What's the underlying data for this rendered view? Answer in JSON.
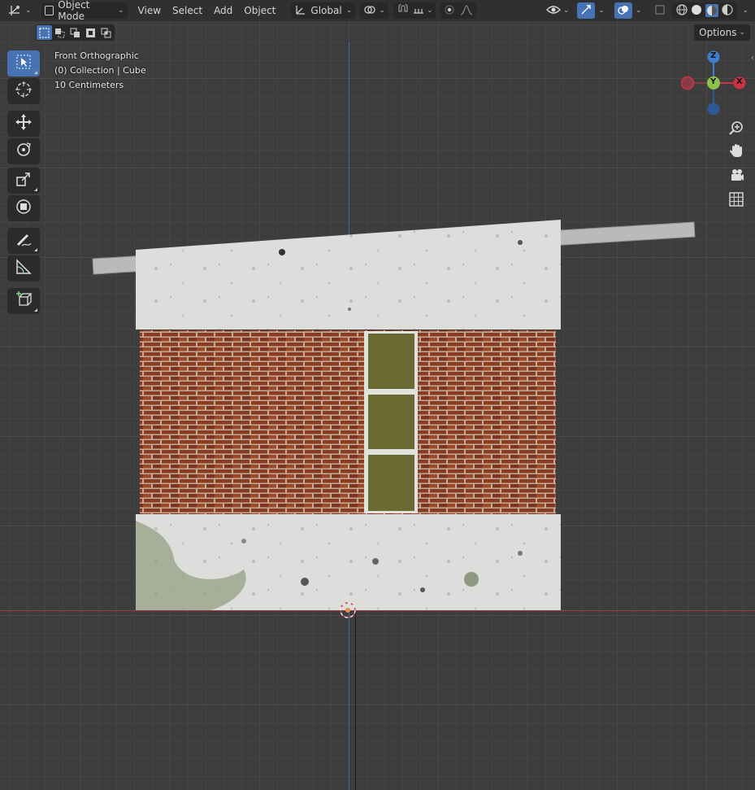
{
  "header": {
    "editor_type": "3d-viewport-icon",
    "mode": "Object Mode",
    "menus": [
      "View",
      "Select",
      "Add",
      "Object"
    ],
    "transform_orientation": "Global"
  },
  "subheader": {
    "options_label": "Options"
  },
  "viewport": {
    "view_name": "Front Orthographic",
    "collection_info": "(0) Collection | Cube",
    "scale_info": "10 Centimeters"
  },
  "gizmo": {
    "z_label": "Z",
    "y_label": "Y",
    "x_label": "X"
  },
  "colors": {
    "accent": "#4772b3",
    "x_axis": "#cc3344",
    "y_axis": "#8bc34a",
    "z_axis": "#3f7fd1",
    "brick": "#8a3a22",
    "door": "#6b6a32",
    "plaster": "#dcdcda"
  },
  "tools": [
    "select-box-icon",
    "cursor-icon",
    "move-icon",
    "rotate-icon",
    "scale-icon",
    "transform-icon",
    "annotate-icon",
    "measure-icon",
    "add-cube-icon"
  ]
}
